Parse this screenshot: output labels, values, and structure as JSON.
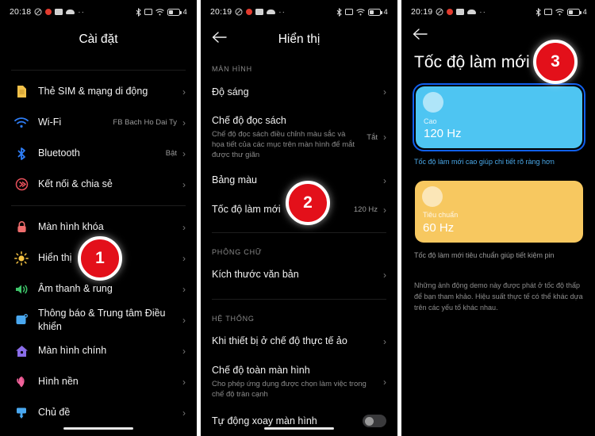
{
  "status_bar": {
    "time_1": "20:18",
    "time_2": "20:19",
    "time_3": "20:19",
    "ellipsis": "··",
    "network_label": "4"
  },
  "panel1": {
    "title": "Cài đặt",
    "items": [
      {
        "label": "Thẻ SIM & mạng di động",
        "value": "",
        "icon": "sim-card-icon",
        "color": "#f2c14a"
      },
      {
        "label": "Wi-Fi",
        "value": "FB Bach Ho Dai Ty",
        "icon": "wifi-icon",
        "color": "#2e7df6"
      },
      {
        "label": "Bluetooth",
        "value": "Bật",
        "icon": "bluetooth-icon",
        "color": "#2e7df6"
      },
      {
        "label": "Kết nối & chia sẻ",
        "value": "",
        "icon": "share-connection-icon",
        "color": "#e8505b"
      }
    ],
    "items2": [
      {
        "label": "Màn hình khóa",
        "value": "",
        "icon": "lock-icon",
        "color": "#ef6d6d"
      },
      {
        "label": "Hiển thị",
        "value": "",
        "icon": "brightness-sun-icon",
        "color": "#f5c242"
      },
      {
        "label": "Âm thanh & rung",
        "value": "",
        "icon": "speaker-icon",
        "color": "#3ec46a"
      },
      {
        "label": "Thông báo & Trung tâm Điều khiển",
        "value": "",
        "icon": "notification-icon",
        "color": "#4aa8f0"
      },
      {
        "label": "Màn hình chính",
        "value": "",
        "icon": "home-icon",
        "color": "#8a6de9"
      },
      {
        "label": "Hình nền",
        "value": "",
        "icon": "wallpaper-flower-icon",
        "color": "#f0639a"
      },
      {
        "label": "Chủ đề",
        "value": "",
        "icon": "theme-brush-icon",
        "color": "#4aa8f0"
      }
    ]
  },
  "panel2": {
    "title": "Hiển thị",
    "section_screen": "MÀN HÌNH",
    "section_font": "PHÔNG CHỮ",
    "section_system": "HỆ THỐNG",
    "items_screen": [
      {
        "label": "Độ sáng",
        "sub": "",
        "value": ""
      },
      {
        "label": "Chế độ đọc sách",
        "sub": "Chế độ đọc sách điều chỉnh màu sắc và họa tiết của các mục trên màn hình để mắt được thư giãn",
        "value": "Tắt"
      },
      {
        "label": "Bảng màu",
        "sub": "",
        "value": ""
      },
      {
        "label": "Tốc độ làm mới",
        "sub": "",
        "value": "120 Hz"
      }
    ],
    "items_font": [
      {
        "label": "Kích thước văn bản",
        "sub": "",
        "value": ""
      }
    ],
    "items_system": [
      {
        "label": "Khi thiết bị ở chế độ thực tế ảo",
        "sub": "",
        "value": ""
      },
      {
        "label": "Chế độ toàn màn hình",
        "sub": "Cho phép ứng dụng được chọn làm việc trong chế độ tràn cạnh",
        "value": ""
      }
    ],
    "auto_rotate": {
      "label": "Tự động xoay màn hình",
      "enabled": false
    }
  },
  "panel3": {
    "title": "Tốc độ làm mới",
    "options": [
      {
        "name": "Cao",
        "rate": "120 Hz",
        "note": "Tốc độ làm mới cao giúp chi tiết rõ ràng hơn",
        "selected": true,
        "fill": "#4ec5f2",
        "ring": "#1060f0",
        "note_color": "#4aa8e8"
      },
      {
        "name": "Tiêu chuẩn",
        "rate": "60 Hz",
        "note": "Tốc độ làm mới tiêu chuẩn giúp tiết kiệm pin",
        "selected": false,
        "fill": "#f7c860",
        "ring": "transparent",
        "note_color": "#9a9a9a"
      }
    ],
    "footnote": "Những ảnh động demo này được phát ở tốc độ thấp để bạn tham khảo. Hiệu suất thực tế có thể khác dựa trên các yếu tố khác nhau."
  },
  "badges": {
    "one": "1",
    "two": "2",
    "three": "3",
    "color": "#e3101a"
  }
}
